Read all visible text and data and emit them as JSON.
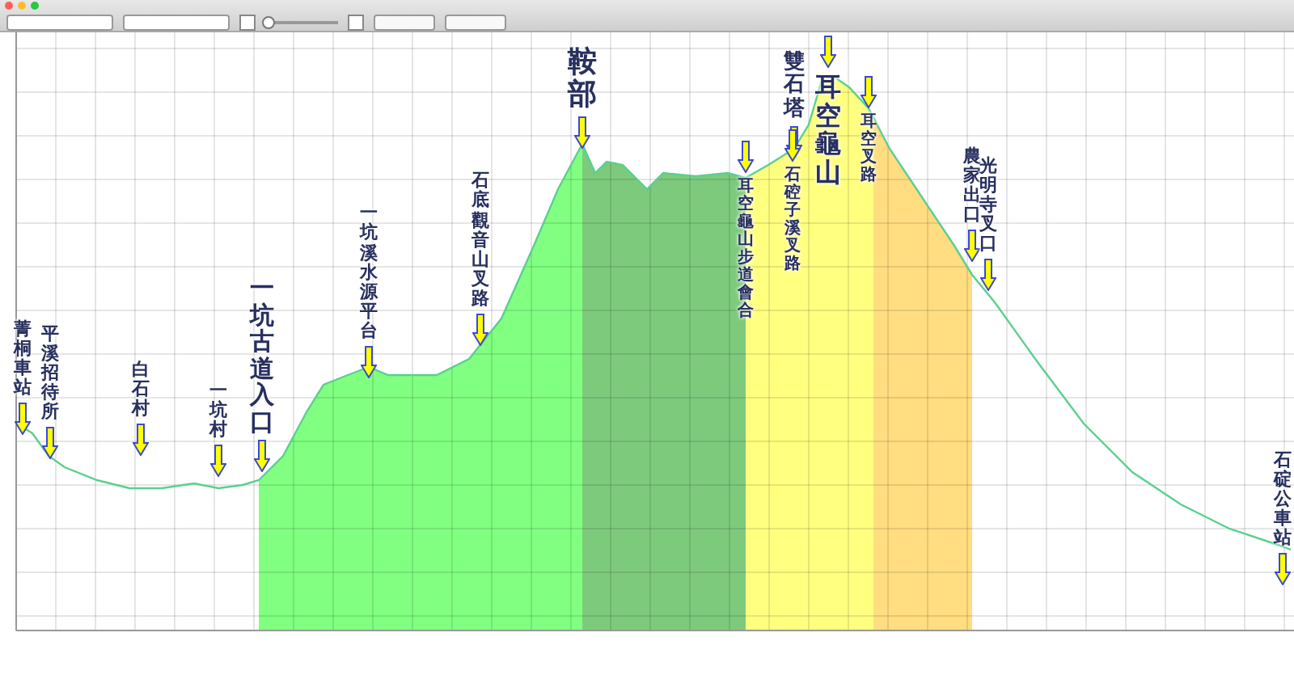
{
  "toolbar": {
    "zoom": {
      "level": 0.05
    }
  },
  "chart": {
    "segments": [
      {
        "color": "#80ff80"
      },
      {
        "color": "#7dca7d"
      },
      {
        "color": "#ffff80"
      },
      {
        "color": "#ffdd80"
      }
    ],
    "markers": [
      {
        "label": "菁桐車站"
      },
      {
        "label": "平溪招待所"
      },
      {
        "label": "白石村"
      },
      {
        "label": "一坑村"
      },
      {
        "label": "一坑古道入口"
      },
      {
        "label": "一坑溪水源平台"
      },
      {
        "label": "石底觀音山叉路"
      },
      {
        "label": "鞍部"
      },
      {
        "label": "耳空龜山步道會合"
      },
      {
        "label": "雙石塔"
      },
      {
        "label": "石硿子溪叉路"
      },
      {
        "label": "耳空龜山"
      },
      {
        "label": "耳空叉路"
      },
      {
        "label": "農家出口"
      },
      {
        "label": "光明寺叉口"
      },
      {
        "label": "石碇公車站"
      }
    ]
  }
}
